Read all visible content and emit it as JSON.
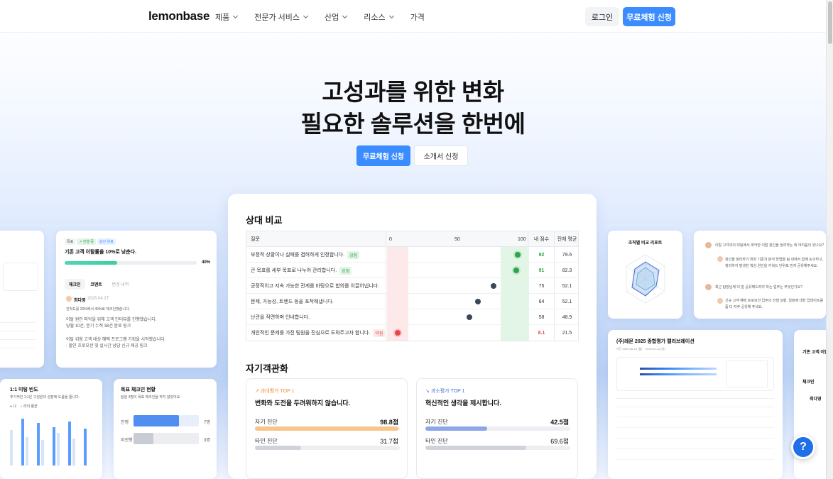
{
  "nav": {
    "logo": "lemonbase",
    "menu": [
      "제품",
      "전문가 서비스",
      "산업",
      "리소스"
    ],
    "price": "가격",
    "login": "로그인",
    "trial": "무료체험 신청"
  },
  "hero": {
    "line1": "고성과를 위한 변화",
    "line2": "필요한 솔루션을 한번에",
    "cta_primary": "무료체험 신청",
    "cta_secondary": "소개서 신청"
  },
  "compare": {
    "title": "상대 비교",
    "head": {
      "q": "질문",
      "t0": "0",
      "t50": "50",
      "t100": "100",
      "my": "내 점수",
      "avg": "전체 평균"
    },
    "rows": [
      {
        "q": "부정적 상황이나 실패를 겸허하게 인정합니다.",
        "tag": "강점",
        "tone": "green",
        "my": "92",
        "avg": "79.6"
      },
      {
        "q": "큰 목표를 세부 목표로 나누어 관리합니다.",
        "tag": "강점",
        "tone": "green",
        "my": "91",
        "avg": "82.3"
      },
      {
        "q": "긍정적이고 지속 가능한 관계를 바탕으로 합의를 이끌어냅니다.",
        "tag": "",
        "tone": "neutral",
        "my": "75",
        "avg": "52.1"
      },
      {
        "q": "문제, 가능성, 트렌드 등을 포착해냅니다.",
        "tag": "",
        "tone": "neutral",
        "my": "64",
        "avg": "52.1"
      },
      {
        "q": "난관을 직면하며 인내합니다.",
        "tag": "",
        "tone": "neutral",
        "my": "58",
        "avg": "48.9"
      },
      {
        "q": "개인적인 문제를 가진 팀원을 진심으로 도와주고자 합니다.",
        "tag": "약점",
        "tone": "red",
        "my": "8.1",
        "avg": "21.5"
      }
    ]
  },
  "self": {
    "title": "자기객관화",
    "over": {
      "badge": "과대평가 TOP 1",
      "text": "변화와 도전을 두려워하지 않습니다.",
      "self_label": "자기 진단",
      "self_val": "98.8점",
      "other_label": "타인 진단",
      "other_val": "31.7점",
      "self_pct": 0.988,
      "other_pct": 0.317
    },
    "under": {
      "badge": "과소평가 TOP 1",
      "text": "혁신적인 생각을 제시합니다.",
      "self_label": "자기 진단",
      "self_val": "42.5점",
      "other_label": "타인 진단",
      "other_val": "69.6점",
      "self_pct": 0.425,
      "other_pct": 0.696
    }
  },
  "goal": {
    "badges": [
      "목표",
      "↗ 진행 중",
      "승인 완료"
    ],
    "title": "기존 고객 이탈률을 10%로 낮춘다.",
    "pct": "40%",
    "progress": 0.4,
    "tabs": [
      "체크인",
      "코멘트",
      "변경 내역"
    ],
    "author": "최다영",
    "date": "2025.04.27",
    "line1": "진척도를 20%에서 40%로 체크인했습니다.",
    "line2": "이탈 원인 파악을 위해 고객 인터뷰를 진행했습니다.",
    "line3": "당월 10건, 분기 누적 38건 완료 링크",
    "line4": "이탈 위험 고객 대상 혜택 프로그램 기획을 시작했습니다.",
    "line5": "- 할인 프로모션 및 실시간 상담 신규 제공 링크"
  },
  "meeting": {
    "title": "1:1 미팅 빈도",
    "desc": "주기적인 1:1은 구성원의 성장에 도움을 줍니다.",
    "legend": [
      "나",
      "리더 평균"
    ]
  },
  "checkin": {
    "title": "목표 체크인 현황",
    "desc": "팀원 3명이 목표 체크인을 하지 않았어요.",
    "rows": [
      {
        "label": "진행",
        "val": "7명",
        "pct": 0.7
      },
      {
        "label": "미진행",
        "val": "3명",
        "pct": 0.3
      }
    ]
  },
  "org": {
    "title": "조직별 비교 리포트"
  },
  "qa": {
    "q1": "이탈 고객과의 미팅에서 파악한 이탈 원인을 정리하는 데 어려움이 있나요?",
    "a1": "원인을 정리하기 위한 기준과 분석 방법을 팀 내에서 함께 논의하고, 정리하지 발생한 핵심 원인을 키워드 단위로 먼저 공유해주세요.",
    "q2": "최근 팀장님께 더 잘 공유해드려야 하는 업무는 무엇인가요?",
    "a2": "신규 고객 혜택 프로모션 업무의 진행 상황, 일정에 대한 업데이트를 좀 더 자주 공유해 주세요."
  },
  "calib": {
    "title": "(주)레몬 2025 종합평가 캘리브레이션",
    "period": "기간 2025-06-10 (월) ~ 2025-10-13 (일)"
  },
  "right_partial": {
    "title": "기존 고객 이탈",
    "tab": "체크인",
    "author": "최다영"
  },
  "help": "?"
}
